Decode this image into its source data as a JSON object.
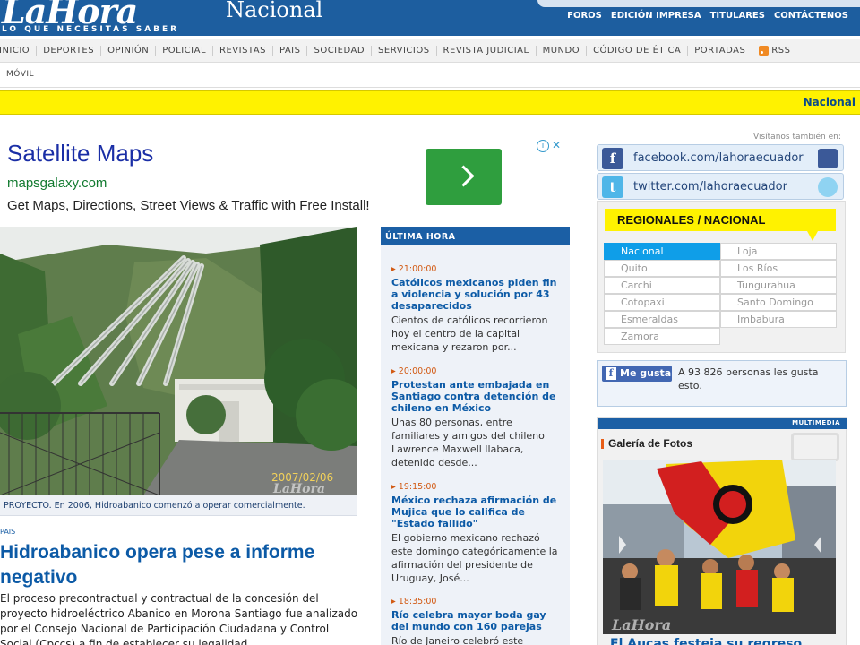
{
  "header": {
    "logo": "LaHora",
    "tagline": "LO QUE NECESITAS SABER",
    "section": "Nacional",
    "links": [
      "FOROS",
      "EDICIÓN IMPRESA",
      "TITULARES",
      "CONTÁCTENOS"
    ]
  },
  "nav": {
    "items": [
      "INICIO",
      "DEPORTES",
      "OPINIÓN",
      "POLICIAL",
      "REVISTAS",
      "PAIS",
      "SOCIEDAD",
      "SERVICIOS",
      "REVISTA JUDICIAL",
      "MUNDO",
      "CÓDIGO DE ÉTICA",
      "PORTADAS"
    ],
    "rss": "RSS",
    "sub": "MÓVIL"
  },
  "breadcrumb": {
    "current": "Nacional"
  },
  "ad": {
    "title": "Satellite Maps",
    "url": "mapsgalaxy.com",
    "description": "Get Maps, Directions, Street Views & Traffic with Free Install!",
    "close": "✕",
    "info": "i"
  },
  "article": {
    "photo_stamp_date": "2007/02/06",
    "photo_watermark": "LaHora",
    "caption": "PROYECTO. En 2006, Hidroabanico comenzó a operar comercialmente.",
    "section": "PAIS",
    "title": "Hidroabanico opera pese a informe negativo",
    "body": "El proceso precontractual y contractual de la concesión del proyecto hidroeléctrico Abanico en Morona Santiago fue analizado por el Consejo Nacional de Participación Ciudadana y Control Social (Cpccs) a fin de establecer su legalidad."
  },
  "ultima_hora": {
    "header": "ÚLTIMA HORA",
    "items": [
      {
        "time": "21:00:00",
        "headline": "Católicos mexicanos piden fin a violencia y solución por 43 desaparecidos",
        "summary": "Cientos de católicos recorrieron hoy el centro de la capital mexicana y rezaron por..."
      },
      {
        "time": "20:00:00",
        "headline": "Protestan ante embajada en Santiago contra detención de chileno en México",
        "summary": "Unas 80 personas, entre familiares y amigos del chileno Lawrence Maxwell Ilabaca, detenido desde..."
      },
      {
        "time": "19:15:00",
        "headline": "México rechaza afirmación de Mujica que lo califica de \"Estado fallido\"",
        "summary": "El gobierno mexicano rechazó este domingo categóricamente la afirmación del presidente de Uruguay, José..."
      },
      {
        "time": "18:35:00",
        "headline": "Río celebra mayor boda gay del mundo con 160 parejas",
        "summary": "Río de Janeiro celebró este"
      }
    ]
  },
  "sidebar": {
    "visit_label": "Visítanos también en:",
    "facebook": "facebook.com/lahoraecuador",
    "twitter": "twitter.com/lahoraecuador",
    "regional_title": "REGIONALES / NACIONAL",
    "regions_left": [
      "Nacional",
      "Quito",
      "Carchi",
      "Cotopaxi",
      "Esmeraldas",
      "Zamora"
    ],
    "regions_right": [
      "Loja",
      "Los Ríos",
      "Tungurahua",
      "Santo Domingo",
      "Imbabura"
    ],
    "like_button": "Me gusta",
    "like_text": "A 93 826 personas les gusta esto.",
    "multimedia_label": "MULTIMEDIA",
    "gallery_title": "Galería de Fotos",
    "gallery_watermark": "LaHora",
    "gallery_caption": "El Aucas festeja su regreso"
  },
  "colors": {
    "brand_blue": "#1d5e9f",
    "link_blue": "#0c5aa6",
    "highlight_yellow": "#fff200",
    "time_orange": "#d25a13",
    "active_region": "#0f9ee8"
  }
}
